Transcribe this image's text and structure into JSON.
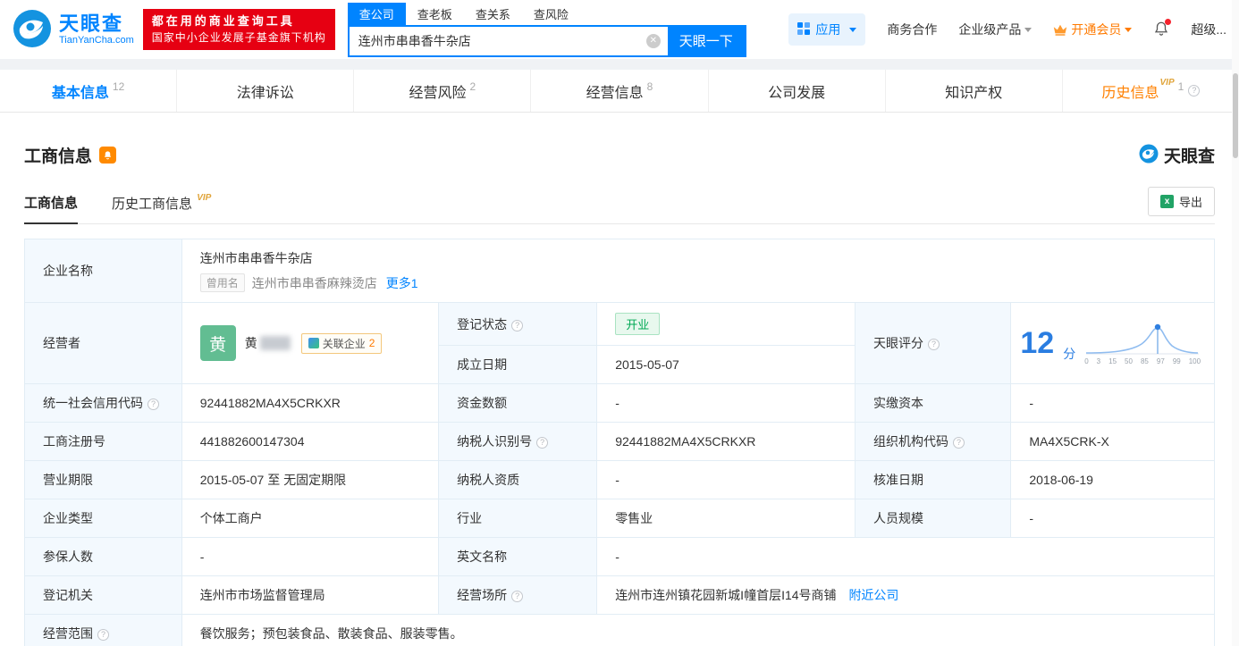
{
  "header": {
    "logo": {
      "title": "天眼查",
      "domain": "TianYanCha.com"
    },
    "promo": {
      "line1": "都在用的商业查询工具",
      "line2": "国家中小企业发展子基金旗下机构"
    },
    "search_tabs": [
      {
        "label": "查公司"
      },
      {
        "label": "查老板"
      },
      {
        "label": "查关系"
      },
      {
        "label": "查风险"
      }
    ],
    "search": {
      "value": "连州市串串香牛杂店",
      "button": "天眼一下"
    },
    "nav": {
      "apps": "应用",
      "cooperation": "商务合作",
      "enterprise": "企业级产品",
      "vip": "开通会员",
      "super": "超级..."
    }
  },
  "tabs": [
    {
      "label": "基本信息",
      "count": "12"
    },
    {
      "label": "法律诉讼",
      "count": ""
    },
    {
      "label": "经营风险",
      "count": "2"
    },
    {
      "label": "经营信息",
      "count": "8"
    },
    {
      "label": "公司发展",
      "count": ""
    },
    {
      "label": "知识产权",
      "count": ""
    },
    {
      "label": "历史信息",
      "count": "1",
      "vip": "VIP"
    }
  ],
  "section": {
    "title": "工商信息",
    "brand": "天眼查",
    "subtabs": {
      "current": "工商信息",
      "history": "历史工商信息",
      "history_vip": "VIP"
    },
    "export": "导出"
  },
  "fields": {
    "company_name": {
      "label": "企业名称",
      "value": "连州市串串香牛杂店",
      "former_tag": "曾用名",
      "former_value": "连州市串串香麻辣烫店",
      "more": "更多1"
    },
    "operator": {
      "label": "经营者",
      "avatar": "黄",
      "name": "黄",
      "related": "关联企业",
      "related_count": "2"
    },
    "reg_status": {
      "label": "登记状态",
      "value": "开业"
    },
    "establish_date": {
      "label": "成立日期",
      "value": "2015-05-07"
    },
    "score": {
      "label": "天眼评分",
      "value": "12",
      "unit": "分",
      "axis": [
        "0",
        "3",
        "15",
        "50",
        "85",
        "97",
        "99",
        "100"
      ]
    },
    "credit_code": {
      "label": "统一社会信用代码",
      "value": "92441882MA4X5CRKXR"
    },
    "capital": {
      "label": "资金数额",
      "value": "-"
    },
    "paid_capital": {
      "label": "实缴资本",
      "value": "-"
    },
    "reg_number": {
      "label": "工商注册号",
      "value": "441882600147304"
    },
    "taxpayer_id": {
      "label": "纳税人识别号",
      "value": "92441882MA4X5CRKXR"
    },
    "org_code": {
      "label": "组织机构代码",
      "value": "MA4X5CRK-X"
    },
    "business_term": {
      "label": "营业期限",
      "value": "2015-05-07 至 无固定期限"
    },
    "taxpayer_quality": {
      "label": "纳税人资质",
      "value": "-"
    },
    "approved_date": {
      "label": "核准日期",
      "value": "2018-06-19"
    },
    "company_type": {
      "label": "企业类型",
      "value": "个体工商户"
    },
    "industry": {
      "label": "行业",
      "value": "零售业"
    },
    "staff_size": {
      "label": "人员规模",
      "value": "-"
    },
    "insured_count": {
      "label": "参保人数",
      "value": "-"
    },
    "english_name": {
      "label": "英文名称",
      "value": "-"
    },
    "reg_authority": {
      "label": "登记机关",
      "value": "连州市市场监督管理局"
    },
    "premises": {
      "label": "经营场所",
      "value": "连州市连州镇花园新城I幢首层I14号商铺",
      "nearby": "附近公司"
    },
    "business_scope": {
      "label": "经营范围",
      "value": "餐饮服务；预包装食品、散装食品、服装零售。"
    }
  }
}
